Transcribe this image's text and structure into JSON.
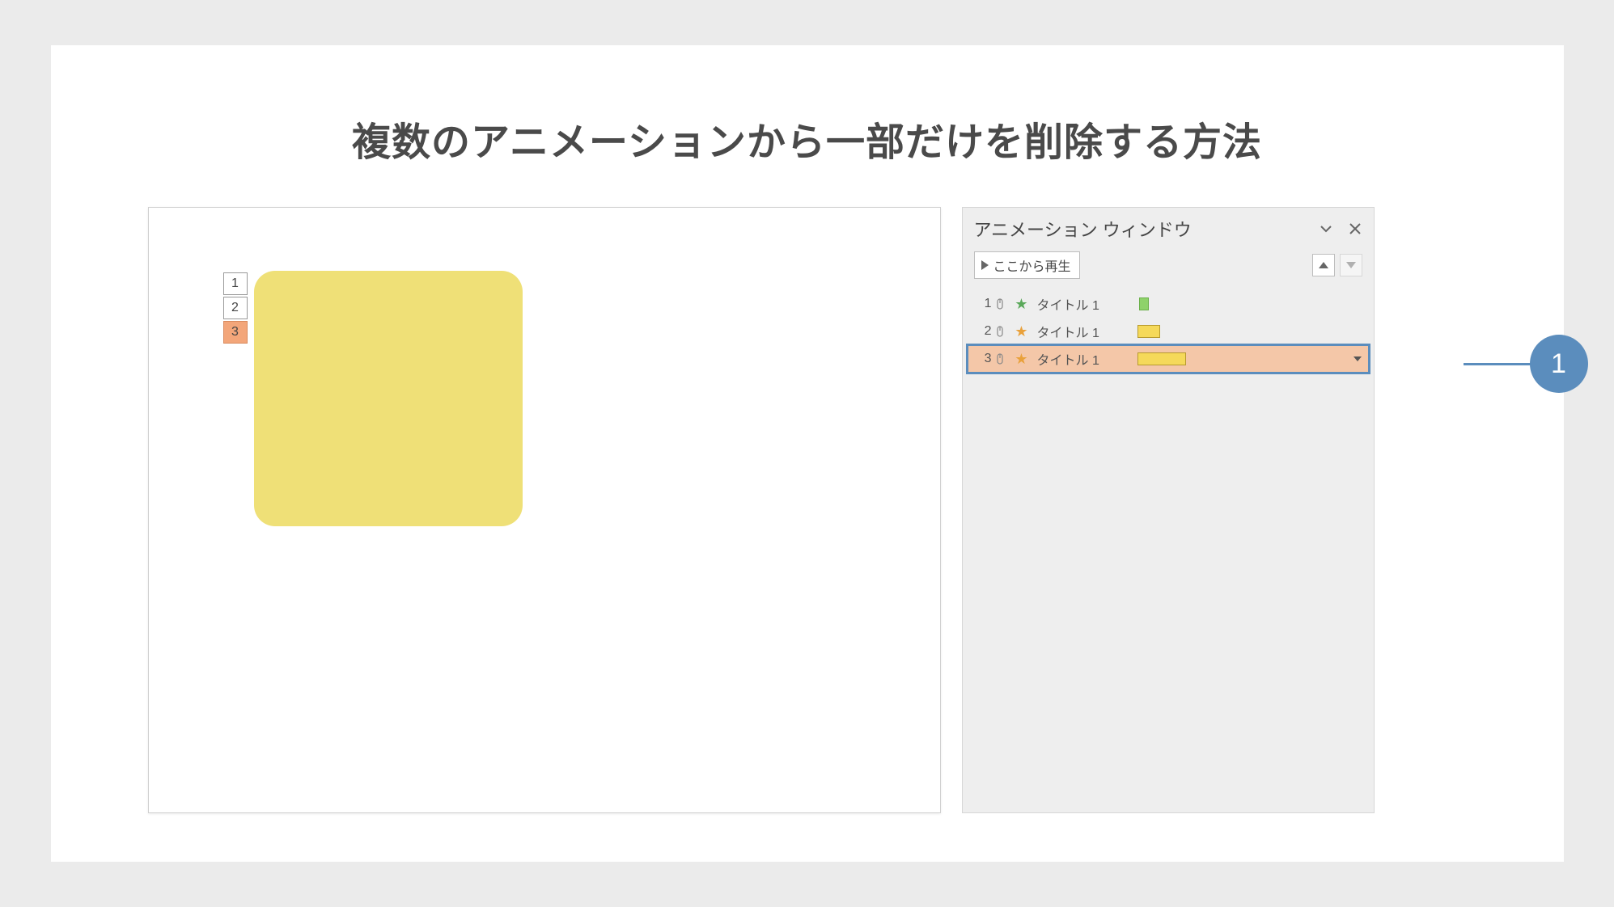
{
  "title": "複数のアニメーションから一部だけを削除する方法",
  "slide": {
    "tags": [
      "1",
      "2",
      "3"
    ],
    "selectedTag": 2
  },
  "animationPane": {
    "title": "アニメーション ウィンドウ",
    "playFrom": "ここから再生",
    "items": [
      {
        "index": "1",
        "starColor": "green",
        "label": "タイトル 1",
        "barClass": "tl1",
        "selected": false
      },
      {
        "index": "2",
        "starColor": "orange",
        "label": "タイトル 1",
        "barClass": "tl2",
        "selected": false
      },
      {
        "index": "3",
        "starColor": "orange",
        "label": "タイトル 1",
        "barClass": "tl3",
        "selected": true
      }
    ]
  },
  "callout": "1"
}
